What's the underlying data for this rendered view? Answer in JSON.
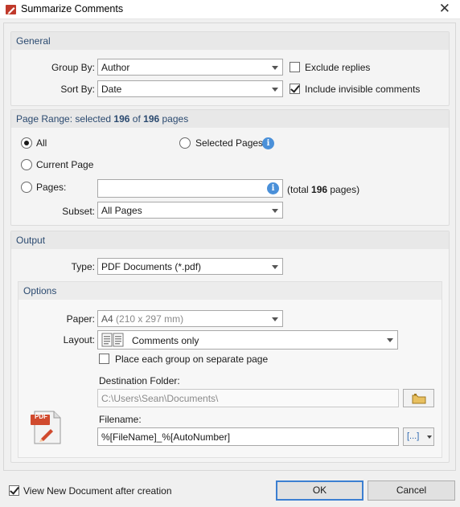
{
  "window": {
    "title": "Summarize Comments",
    "close_glyph": "✕"
  },
  "general": {
    "header": "General",
    "group_by": {
      "label": "Group By:",
      "value": "Author"
    },
    "sort_by": {
      "label": "Sort By:",
      "value": "Date"
    },
    "exclude_replies": {
      "label": "Exclude replies",
      "checked": false
    },
    "include_invisible": {
      "label": "Include invisible comments",
      "checked": true
    }
  },
  "page_range": {
    "header_prefix": "Page Range: selected ",
    "selected": "196",
    "header_mid": " of ",
    "total": "196",
    "header_suffix": " pages",
    "all_label": "All",
    "selected_pages_label": "Selected Pages",
    "current_page_label": "Current Page",
    "pages_label": "Pages:",
    "pages_value": "",
    "total_prefix": "(total ",
    "total_count": "196",
    "total_suffix": " pages)",
    "subset_label": "Subset:",
    "subset_value": "All Pages",
    "selected_option": "All"
  },
  "output": {
    "header": "Output",
    "type_label": "Type:",
    "type_value": "PDF Documents (*.pdf)",
    "options": {
      "header": "Options",
      "paper_label": "Paper:",
      "paper_value": "A4",
      "paper_dims": "(210 x 297 mm)",
      "layout_label": "Layout:",
      "layout_value": "Comments only",
      "separate_page_label": "Place each group on separate page",
      "separate_page_checked": false,
      "destination_label": "Destination Folder:",
      "destination_value": "C:\\Users\\Sean\\Documents\\",
      "filename_label": "Filename:",
      "filename_value": "%[FileName]_%[AutoNumber]",
      "pdf_badge": "PDF",
      "macro_glyph": "[...]"
    }
  },
  "footer": {
    "view_new_label": "View New Document after creation",
    "view_new_checked": true,
    "ok_label": "OK",
    "cancel_label": "Cancel"
  },
  "colors": {
    "accent": "#3c7fd1",
    "header_text": "#2b4a70",
    "pdf_red": "#c0392b",
    "info_blue": "#4a90d9"
  }
}
